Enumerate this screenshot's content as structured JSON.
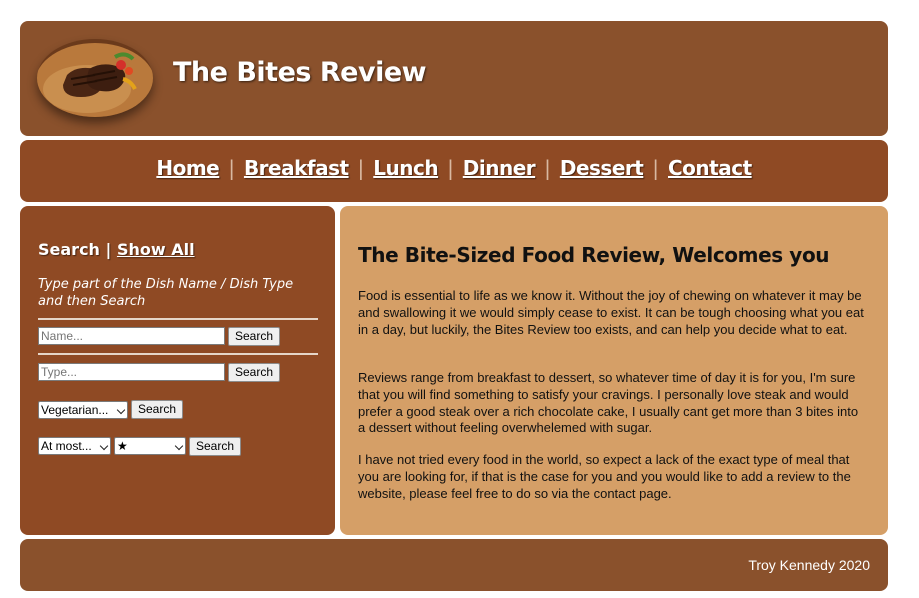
{
  "header": {
    "site_title": "The Bites Review",
    "logo_icon": "steak-dish-image"
  },
  "nav": {
    "items": [
      {
        "label": "Home"
      },
      {
        "label": "Breakfast"
      },
      {
        "label": "Lunch"
      },
      {
        "label": "Dinner"
      },
      {
        "label": "Dessert"
      },
      {
        "label": "Contact"
      }
    ],
    "separator": "|"
  },
  "sidebar": {
    "search_heading": "Search",
    "heading_separator": "|",
    "show_all_link": "Show All",
    "hint": "Type part of the Dish Name / Dish Type and then Search",
    "name_placeholder": "Name...",
    "type_placeholder": "Type...",
    "search_label": "Search",
    "diet_select_value": "Vegetarian...",
    "limit_select_value": "At most...",
    "rating_select_value": "★"
  },
  "main": {
    "title": "The Bite-Sized Food Review, Welcomes you",
    "paragraphs": [
      "Food is essential to life as we know it. Without the joy of chewing on whatever it may be and swallowing it we would simply cease to exist. It can be tough choosing what you eat in a day, but luckily, the Bites Review too exists, and can help you decide what to eat.",
      "Reviews range from breakfast to dessert, so whatever time of day it is for you, I'm sure that you will find something to satisfy your cravings. I personally love steak and would prefer a good steak over a rich chocolate cake, I usually cant get more than 3 bites into a dessert without feeling overwhelemed with sugar.",
      "I have not tried every food in the world, so expect a lack of the exact type of meal that you are looking for, if that is the case for you and you would like to add a review to the website, please feel free to do so via the contact page."
    ]
  },
  "footer": {
    "text": "Troy Kennedy 2020"
  },
  "colors": {
    "header_bg": "#8a512c",
    "nav_bg": "#8f4a24",
    "sidebar_bg": "#8f4a24",
    "main_bg": "#d59f67",
    "footer_bg": "#8a512c"
  }
}
